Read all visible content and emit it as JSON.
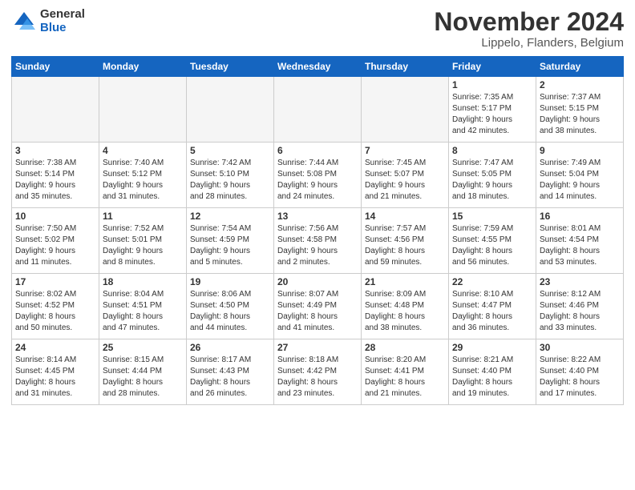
{
  "logo": {
    "general": "General",
    "blue": "Blue"
  },
  "title": "November 2024",
  "location": "Lippelo, Flanders, Belgium",
  "weekdays": [
    "Sunday",
    "Monday",
    "Tuesday",
    "Wednesday",
    "Thursday",
    "Friday",
    "Saturday"
  ],
  "weeks": [
    [
      {
        "day": "",
        "info": ""
      },
      {
        "day": "",
        "info": ""
      },
      {
        "day": "",
        "info": ""
      },
      {
        "day": "",
        "info": ""
      },
      {
        "day": "",
        "info": ""
      },
      {
        "day": "1",
        "info": "Sunrise: 7:35 AM\nSunset: 5:17 PM\nDaylight: 9 hours\nand 42 minutes."
      },
      {
        "day": "2",
        "info": "Sunrise: 7:37 AM\nSunset: 5:15 PM\nDaylight: 9 hours\nand 38 minutes."
      }
    ],
    [
      {
        "day": "3",
        "info": "Sunrise: 7:38 AM\nSunset: 5:14 PM\nDaylight: 9 hours\nand 35 minutes."
      },
      {
        "day": "4",
        "info": "Sunrise: 7:40 AM\nSunset: 5:12 PM\nDaylight: 9 hours\nand 31 minutes."
      },
      {
        "day": "5",
        "info": "Sunrise: 7:42 AM\nSunset: 5:10 PM\nDaylight: 9 hours\nand 28 minutes."
      },
      {
        "day": "6",
        "info": "Sunrise: 7:44 AM\nSunset: 5:08 PM\nDaylight: 9 hours\nand 24 minutes."
      },
      {
        "day": "7",
        "info": "Sunrise: 7:45 AM\nSunset: 5:07 PM\nDaylight: 9 hours\nand 21 minutes."
      },
      {
        "day": "8",
        "info": "Sunrise: 7:47 AM\nSunset: 5:05 PM\nDaylight: 9 hours\nand 18 minutes."
      },
      {
        "day": "9",
        "info": "Sunrise: 7:49 AM\nSunset: 5:04 PM\nDaylight: 9 hours\nand 14 minutes."
      }
    ],
    [
      {
        "day": "10",
        "info": "Sunrise: 7:50 AM\nSunset: 5:02 PM\nDaylight: 9 hours\nand 11 minutes."
      },
      {
        "day": "11",
        "info": "Sunrise: 7:52 AM\nSunset: 5:01 PM\nDaylight: 9 hours\nand 8 minutes."
      },
      {
        "day": "12",
        "info": "Sunrise: 7:54 AM\nSunset: 4:59 PM\nDaylight: 9 hours\nand 5 minutes."
      },
      {
        "day": "13",
        "info": "Sunrise: 7:56 AM\nSunset: 4:58 PM\nDaylight: 9 hours\nand 2 minutes."
      },
      {
        "day": "14",
        "info": "Sunrise: 7:57 AM\nSunset: 4:56 PM\nDaylight: 8 hours\nand 59 minutes."
      },
      {
        "day": "15",
        "info": "Sunrise: 7:59 AM\nSunset: 4:55 PM\nDaylight: 8 hours\nand 56 minutes."
      },
      {
        "day": "16",
        "info": "Sunrise: 8:01 AM\nSunset: 4:54 PM\nDaylight: 8 hours\nand 53 minutes."
      }
    ],
    [
      {
        "day": "17",
        "info": "Sunrise: 8:02 AM\nSunset: 4:52 PM\nDaylight: 8 hours\nand 50 minutes."
      },
      {
        "day": "18",
        "info": "Sunrise: 8:04 AM\nSunset: 4:51 PM\nDaylight: 8 hours\nand 47 minutes."
      },
      {
        "day": "19",
        "info": "Sunrise: 8:06 AM\nSunset: 4:50 PM\nDaylight: 8 hours\nand 44 minutes."
      },
      {
        "day": "20",
        "info": "Sunrise: 8:07 AM\nSunset: 4:49 PM\nDaylight: 8 hours\nand 41 minutes."
      },
      {
        "day": "21",
        "info": "Sunrise: 8:09 AM\nSunset: 4:48 PM\nDaylight: 8 hours\nand 38 minutes."
      },
      {
        "day": "22",
        "info": "Sunrise: 8:10 AM\nSunset: 4:47 PM\nDaylight: 8 hours\nand 36 minutes."
      },
      {
        "day": "23",
        "info": "Sunrise: 8:12 AM\nSunset: 4:46 PM\nDaylight: 8 hours\nand 33 minutes."
      }
    ],
    [
      {
        "day": "24",
        "info": "Sunrise: 8:14 AM\nSunset: 4:45 PM\nDaylight: 8 hours\nand 31 minutes."
      },
      {
        "day": "25",
        "info": "Sunrise: 8:15 AM\nSunset: 4:44 PM\nDaylight: 8 hours\nand 28 minutes."
      },
      {
        "day": "26",
        "info": "Sunrise: 8:17 AM\nSunset: 4:43 PM\nDaylight: 8 hours\nand 26 minutes."
      },
      {
        "day": "27",
        "info": "Sunrise: 8:18 AM\nSunset: 4:42 PM\nDaylight: 8 hours\nand 23 minutes."
      },
      {
        "day": "28",
        "info": "Sunrise: 8:20 AM\nSunset: 4:41 PM\nDaylight: 8 hours\nand 21 minutes."
      },
      {
        "day": "29",
        "info": "Sunrise: 8:21 AM\nSunset: 4:40 PM\nDaylight: 8 hours\nand 19 minutes."
      },
      {
        "day": "30",
        "info": "Sunrise: 8:22 AM\nSunset: 4:40 PM\nDaylight: 8 hours\nand 17 minutes."
      }
    ]
  ]
}
